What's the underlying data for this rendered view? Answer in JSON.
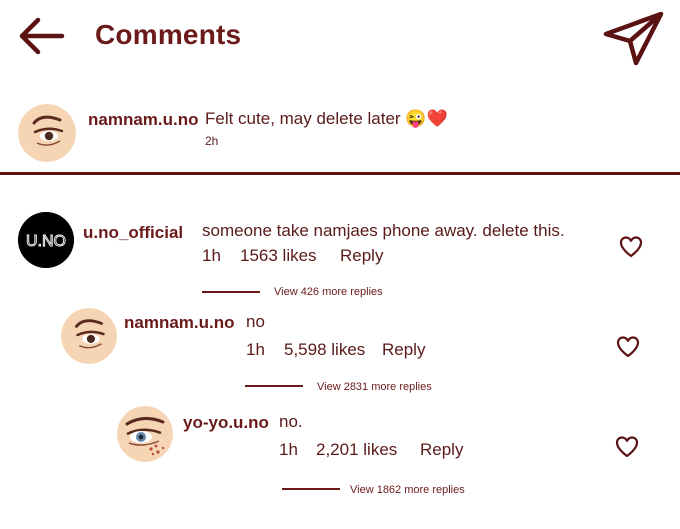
{
  "header": {
    "title": "Comments",
    "back_icon": "arrow-left-icon",
    "send_icon": "paper-plane-icon"
  },
  "post": {
    "username": "namnam.u.no",
    "caption": "Felt cute, may delete later",
    "emoji": "😜❤️",
    "time": "2h"
  },
  "comments": [
    {
      "username": "u.no_official",
      "avatar_text": "U.NO",
      "text": "someone take namjaes phone away. delete this.",
      "time": "1h",
      "likes": "1563 likes",
      "reply": "Reply",
      "view_replies": "View 426 more replies"
    },
    {
      "username": "namnam.u.no",
      "text": "no",
      "time": "1h",
      "likes": "5,598 likes",
      "reply": "Reply",
      "view_replies": "View 2831 more replies"
    },
    {
      "username": "yo-yo.u.no",
      "text": "no.",
      "time": "1h",
      "likes": "2,201 likes",
      "reply": "Reply",
      "view_replies": "View 1862 more replies"
    }
  ],
  "colors": {
    "accent": "#6b1a1a",
    "avatar_skin": "#f6d5b5",
    "avatar_dark": "#000000"
  }
}
